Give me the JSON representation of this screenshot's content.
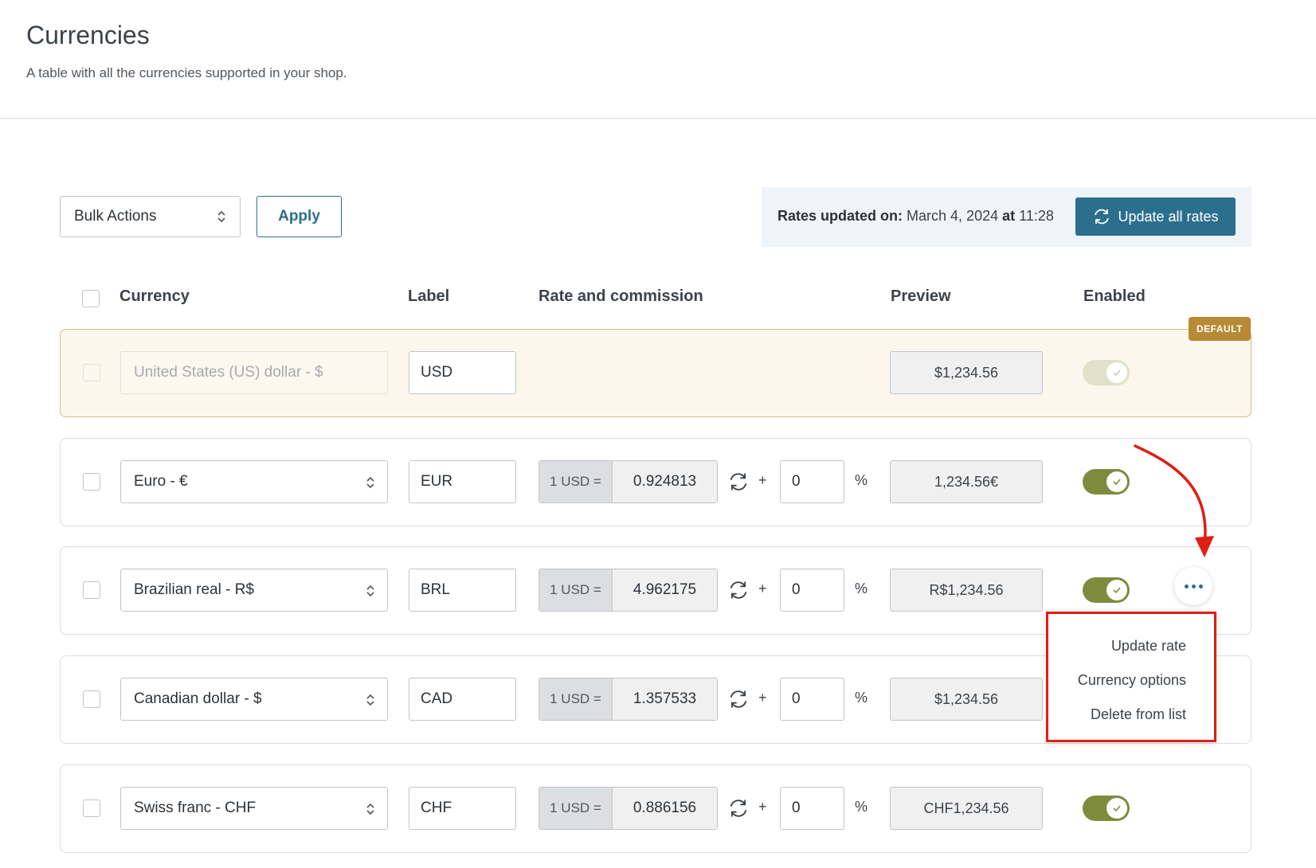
{
  "header": {
    "title": "Currencies",
    "description": "A table with all the currencies supported in your shop."
  },
  "toolbar": {
    "bulk_actions_label": "Bulk Actions",
    "apply_label": "Apply",
    "rates_updated_prefix": "Rates updated on:",
    "rates_updated_date": "March 4, 2024",
    "rates_updated_at": "at",
    "rates_updated_time": "11:28",
    "update_all_label": "Update all rates"
  },
  "table": {
    "columns": {
      "currency": "Currency",
      "label": "Label",
      "rate": "Rate and commission",
      "preview": "Preview",
      "enabled": "Enabled"
    },
    "default_badge": "DEFAULT",
    "rows": [
      {
        "currency": "United States (US) dollar - $",
        "label": "USD",
        "preview": "$1,234.56"
      },
      {
        "currency": "Euro - €",
        "label": "EUR",
        "rate_prefix": "1 USD =",
        "rate": "0.924813",
        "plus": "+",
        "commission": "0",
        "pct": "%",
        "preview": "1,234.56€"
      },
      {
        "currency": "Brazilian real - R$",
        "label": "BRL",
        "rate_prefix": "1 USD =",
        "rate": "4.962175",
        "plus": "+",
        "commission": "0",
        "pct": "%",
        "preview": "R$1,234.56"
      },
      {
        "currency": "Canadian dollar - $",
        "label": "CAD",
        "rate_prefix": "1 USD =",
        "rate": "1.357533",
        "plus": "+",
        "commission": "0",
        "pct": "%",
        "preview": "$1,234.56"
      },
      {
        "currency": "Swiss franc - CHF",
        "label": "CHF",
        "rate_prefix": "1 USD =",
        "rate": "0.886156",
        "plus": "+",
        "commission": "0",
        "pct": "%",
        "preview": "CHF1,234.56"
      }
    ]
  },
  "context_menu": {
    "items": [
      "Update rate",
      "Currency options",
      "Delete from list"
    ]
  },
  "colors": {
    "primary": "#2b6f8d",
    "toggle_on": "#7f8b3c",
    "default_badge": "#b88a35",
    "highlight": "#e01e14"
  }
}
